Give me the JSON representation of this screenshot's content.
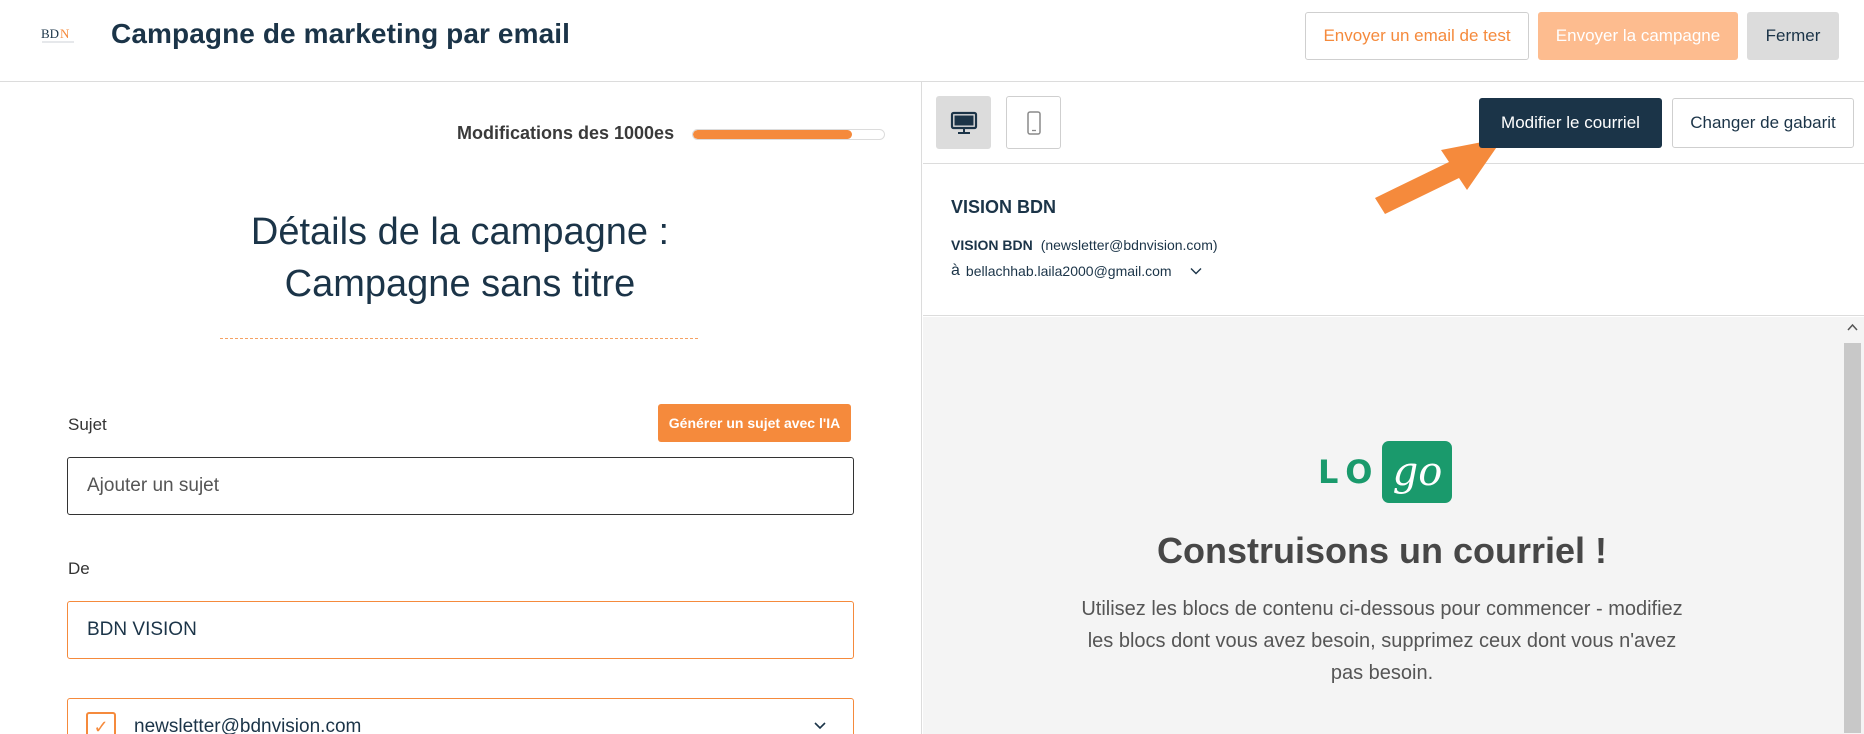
{
  "header": {
    "title": "Campagne de marketing par email",
    "test_label": "Envoyer un email de test",
    "send_label": "Envoyer la campagne",
    "close_label": "Fermer"
  },
  "progress": {
    "label": "Modifications des 1000es",
    "fraction": 0.83
  },
  "campaign": {
    "title_line1": "Détails de la campagne :",
    "title_line2": "Campagne sans titre"
  },
  "form": {
    "subject_label": "Sujet",
    "ai_button": "Générer un sujet avec l'IA",
    "subject_placeholder": "Ajouter un sujet",
    "from_label": "De",
    "from_value": "BDN VISION",
    "email_value": "newsletter@bdnvision.com"
  },
  "preview_toolbar": {
    "edit_label": "Modifier le courriel",
    "template_label": "Changer de gabarit"
  },
  "sender": {
    "name": "VISION BDN",
    "line_name": "VISION BDN",
    "line_email": "(newsletter@bdnvision.com)",
    "to_prefix": "à",
    "to_email": "bellachhab.laila2000@gmail.com"
  },
  "email_preview": {
    "logo_left": "LO",
    "logo_right": "go",
    "heading": "Construisons un courriel !",
    "body": "Utilisez les blocs de contenu ci-dessous pour commencer - modifiez les blocs dont vous avez besoin, supprimez ceux dont vous n'avez pas besoin."
  },
  "colors": {
    "accent": "#f58a3c",
    "navy": "#1b3448",
    "logo_green": "#1a9a6c"
  }
}
